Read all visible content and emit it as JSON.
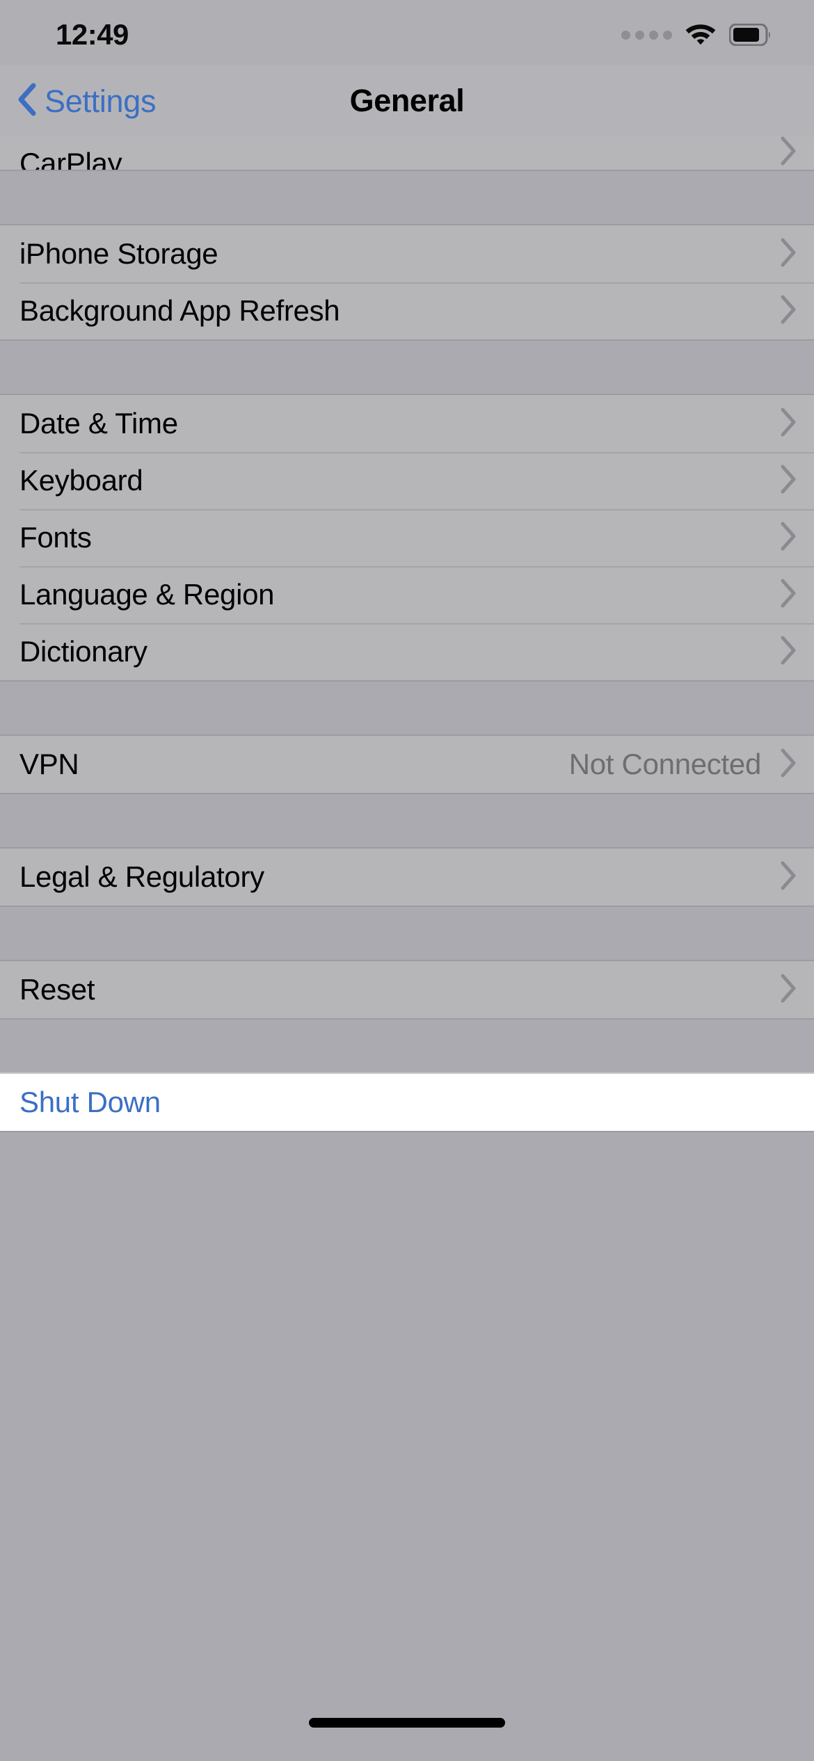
{
  "status_bar": {
    "time": "12:49",
    "signal_icon": "signal-dots-icon",
    "wifi_icon": "wifi-icon",
    "battery_icon": "battery-icon",
    "battery_level_percent": 75
  },
  "nav_bar": {
    "back_label": "Settings",
    "back_icon": "chevron-left-icon",
    "title": "General"
  },
  "colors": {
    "accent_blue": "#3c6fc4",
    "row_background": "#b6b6b9",
    "group_gap": "#aaaab0",
    "secondary_text": "#6d6d72",
    "separator": "#a3a3a9"
  },
  "sections": [
    {
      "id": "carplay-group",
      "clipped_top": true,
      "rows": [
        {
          "label": "CarPlay",
          "value": "",
          "accessory": "chevron-right-icon",
          "name": "row-carplay",
          "clipped": true,
          "tinted": false
        }
      ]
    },
    {
      "id": "storage-group",
      "clipped_top": false,
      "rows": [
        {
          "label": "iPhone Storage",
          "value": "",
          "accessory": "chevron-right-icon",
          "name": "row-iphone-storage",
          "clipped": false,
          "tinted": false
        },
        {
          "label": "Background App Refresh",
          "value": "",
          "accessory": "chevron-right-icon",
          "name": "row-background-app-refresh",
          "clipped": false,
          "tinted": false
        }
      ]
    },
    {
      "id": "localization-group",
      "clipped_top": false,
      "rows": [
        {
          "label": "Date & Time",
          "value": "",
          "accessory": "chevron-right-icon",
          "name": "row-date-and-time",
          "clipped": false,
          "tinted": false
        },
        {
          "label": "Keyboard",
          "value": "",
          "accessory": "chevron-right-icon",
          "name": "row-keyboard",
          "clipped": false,
          "tinted": false
        },
        {
          "label": "Fonts",
          "value": "",
          "accessory": "chevron-right-icon",
          "name": "row-fonts",
          "clipped": false,
          "tinted": false
        },
        {
          "label": "Language & Region",
          "value": "",
          "accessory": "chevron-right-icon",
          "name": "row-language-and-region",
          "clipped": false,
          "tinted": false
        },
        {
          "label": "Dictionary",
          "value": "",
          "accessory": "chevron-right-icon",
          "name": "row-dictionary",
          "clipped": false,
          "tinted": false
        }
      ]
    },
    {
      "id": "vpn-group",
      "clipped_top": false,
      "rows": [
        {
          "label": "VPN",
          "value": "Not Connected",
          "accessory": "chevron-right-icon",
          "name": "row-vpn",
          "clipped": false,
          "tinted": false
        }
      ]
    },
    {
      "id": "legal-group",
      "clipped_top": false,
      "rows": [
        {
          "label": "Legal & Regulatory",
          "value": "",
          "accessory": "chevron-right-icon",
          "name": "row-legal-and-regulatory",
          "clipped": false,
          "tinted": false
        }
      ]
    },
    {
      "id": "reset-group",
      "clipped_top": false,
      "rows": [
        {
          "label": "Reset",
          "value": "",
          "accessory": "chevron-right-icon",
          "name": "row-reset",
          "clipped": false,
          "tinted": false
        }
      ]
    },
    {
      "id": "shutdown-group",
      "clipped_top": false,
      "white": true,
      "rows": [
        {
          "label": "Shut Down",
          "value": "",
          "accessory": "",
          "name": "row-shut-down",
          "clipped": false,
          "tinted": true
        }
      ]
    }
  ],
  "home_indicator": "home-indicator-bar"
}
